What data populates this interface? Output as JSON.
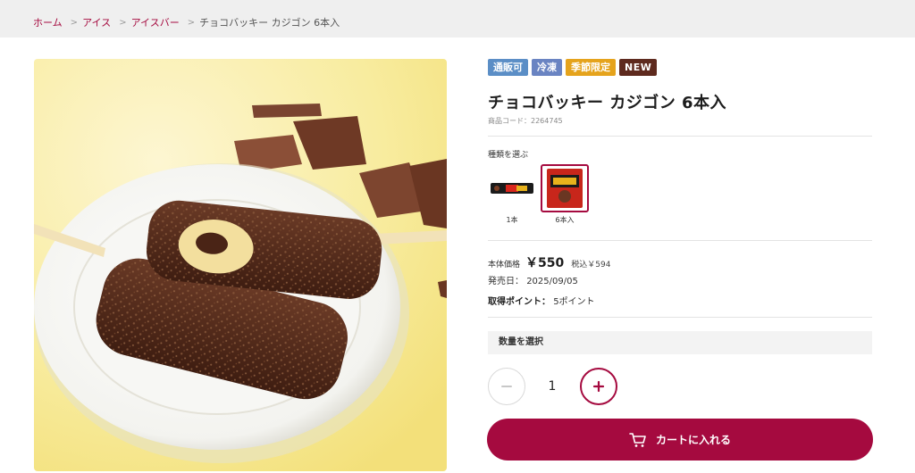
{
  "breadcrumb": {
    "items": [
      "ホーム",
      "アイス",
      "アイスバー"
    ],
    "separator": ">",
    "current": "チョコバッキー カジゴン 6本入"
  },
  "product": {
    "badges": [
      "通販可",
      "冷凍",
      "季節限定",
      "NEW"
    ],
    "title": "チョコバッキー カジゴン 6本入",
    "code": "商品コード：2264745",
    "image_alt": "chocolate-coated ice bars on a white plate"
  },
  "variants": {
    "heading": "種類を選ぶ",
    "items": [
      {
        "label": "1本",
        "selected": false
      },
      {
        "label": "6本入",
        "selected": true
      }
    ]
  },
  "pricing": {
    "label": "本体価格",
    "price": "￥550",
    "tax_included": "税込￥594"
  },
  "release": {
    "label": "発売日：",
    "date": "2025/09/05"
  },
  "points": {
    "label": "取得ポイント：",
    "value": "5ポイント"
  },
  "quantity": {
    "heading": "数量を選択",
    "value": "1",
    "minus_icon": "minus-icon",
    "plus_icon": "plus-icon"
  },
  "cart": {
    "label": "カートに入れる",
    "icon": "cart-icon"
  },
  "colors": {
    "brand": "#a50a3f",
    "badge_blue": "#5b8ec6",
    "badge_steel": "#6a84c2",
    "badge_amber": "#e5a31c",
    "badge_brown": "#5e2a1e"
  }
}
